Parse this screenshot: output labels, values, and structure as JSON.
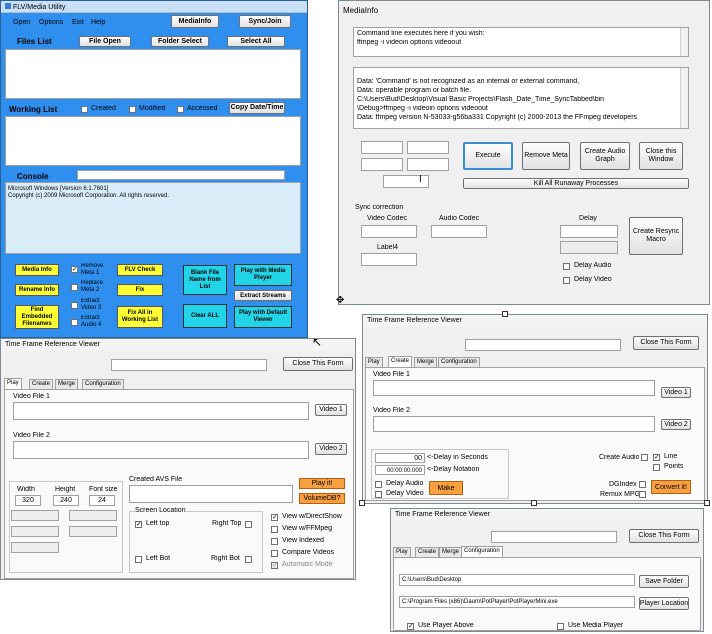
{
  "flv": {
    "title": "FLV/Media Utility",
    "menu": [
      "Open",
      "Options",
      "Exit",
      "Help"
    ],
    "btn_mediainfo": "MediaInfo",
    "btn_sync": "Sync/Join",
    "files_list": "Files List",
    "btn_fileopen": "File Open",
    "btn_folderselect": "Folder Select",
    "btn_selectall": "Select All",
    "working_list": "Working List",
    "chk_created": "Created",
    "chk_modified": "Modified",
    "chk_accessed": "Accessed",
    "btn_copydate": "Copy Date/Time",
    "console": "Console",
    "console_line1": "Microsoft Windows [Version 6.1.7601]",
    "console_line2": "Copyright (c) 2009 Microsoft Corporation.  All rights reserved.",
    "btn_mediainfo2": "Media Info",
    "btn_renameinfo": "Rename Info",
    "btn_findembedded": "Find Embedded Filenames",
    "chk_removemeta1": "Remove Meta  1",
    "chk_replacemeta2": "Replace Meta  2",
    "chk_extractvideo3": "Extract Video  3",
    "chk_extractaudio4": "Extract Audio  4",
    "btn_flvcheck": "FLV Check",
    "btn_fix": "Fix",
    "btn_fixall": "Fix All in Working List",
    "btn_blankfile": "Blank File Name from List",
    "btn_clearall": "Clear ALL",
    "btn_playmedia": "Play with Media Player",
    "btn_extractstreams": "Extract Streams",
    "btn_playdefault": "Play with Default Viewer"
  },
  "mi": {
    "title": "MediaInfo",
    "cmd_line1": "Command line executes here if you wish:",
    "cmd_line2": "ffmpeg -i videoin options videoout",
    "out_lines": [
      "Data: 'Command' is not recognized as an internal or external command,",
      "Data: operable program or batch file.",
      "C:\\Users\\Bud\\Desktop\\Visual Basic Projects\\Flash_Date_Time_SyncTabbed\\bin",
      "\\Debug>ffmpeg -i videoin options videoout",
      "Data: ffmpeg version N-53033-g56ba331 Copyright (c) 2000-2013 the FFmpeg developers"
    ],
    "btn_execute": "Execute",
    "btn_removemeta": "Remove Meta",
    "btn_audiograph": "Create Audio Graph",
    "btn_close": "Close this Window",
    "btn_kill": "Kill All Runaway Processes",
    "sync_correction": "Sync correction",
    "video_codec": "Video Codec",
    "audio_codec": "Audio Codec",
    "delay": "Delay",
    "label4": "Label4",
    "btn_resync": "Create Resync Macro",
    "chk_delayaudio": "Delay Audio",
    "chk_delayvideo": "Delay Video"
  },
  "tf1": {
    "title": "Time Frame Reference Viewer",
    "btn_close": "Close This Form",
    "tabs": [
      "Play",
      "Create",
      "Merge",
      "Configuration"
    ],
    "video1": "Video File 1",
    "btn_video1": "Video 1",
    "video2": "Video File 2",
    "btn_video2": "Video 2",
    "width": "Width",
    "height": "Height",
    "fontsize": "Font size",
    "width_val": "320",
    "height_val": "240",
    "fontsize_val": "24",
    "avs": "Created AVS File",
    "btn_play": "Play it!",
    "btn_volumedb": "VolumeDB?",
    "screen_location": "Screen Location",
    "chk_lefttop": "Left top",
    "chk_righttop": "Right Top",
    "chk_leftbot": "Left Bot",
    "chk_rightbot": "Right  Bot",
    "chk_directshow": "View w/DirectShow",
    "chk_ffmpeg": "View w/FFMpeg",
    "chk_indexed": "View Indexed",
    "chk_compare": "Compare Videos",
    "chk_automatic": "Automatic Mode"
  },
  "tf2": {
    "title": "Time Frame Reference Viewer",
    "btn_close": "Close This Form",
    "tabs": [
      "Play",
      "Create",
      "Merge",
      "Configuration"
    ],
    "video1": "Video File 1",
    "btn_video1": "Video 1",
    "video2": "Video File 2",
    "btn_video2": "Video 2",
    "delay_val": "00",
    "delay_sec": "<-Delay in Seconds",
    "notation_val": "00:00:00.000",
    "delay_notation": "<-Delay Notation",
    "chk_delayaudio": "Delay Audio",
    "chk_delayvideo": "Delay Video",
    "btn_make": "Make",
    "create_audio": "Create Audio",
    "chk_line": "Line",
    "chk_points": "Points",
    "dgindex": "DGIndex",
    "remux": "Remux MPG",
    "btn_convert": "Convert it!"
  },
  "tf3": {
    "title": "Time Frame Reference Viewer",
    "btn_close": "Close This Form",
    "tabs": [
      "Play",
      "Create",
      "Merge",
      "Configuration"
    ],
    "path1": "C:\\Users\\Bud\\Desktop",
    "btn_savefolder": "Save Folder",
    "path2": "C:\\Program Files (x86)\\Daum\\PotPlayer\\PotPlayerMini.exe",
    "btn_playerloc": "Player Location",
    "chk_useplayer": "Use Player Above",
    "chk_usemedia": "Use Media Player"
  },
  "colors": {
    "blue": "#2f8fef",
    "yellow": "#ffff33",
    "cyan": "#22d4e8",
    "orange": "#f8a040"
  }
}
